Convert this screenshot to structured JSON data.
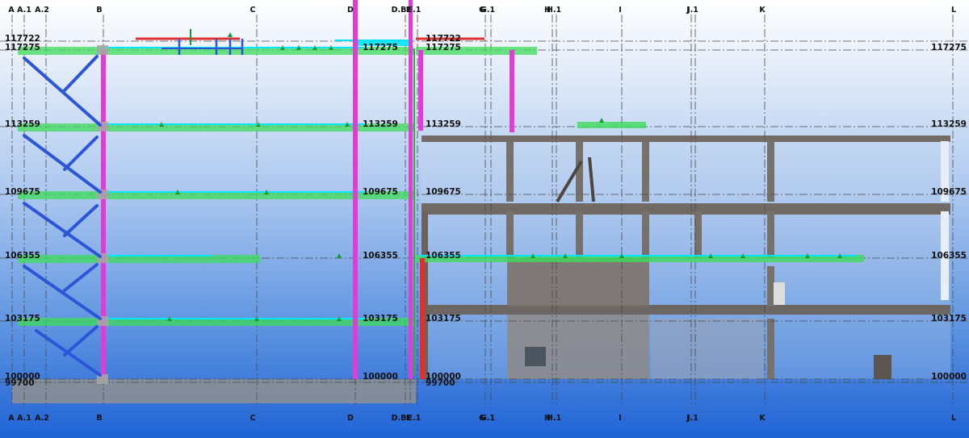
{
  "grids": {
    "labels": [
      "A",
      "A.1",
      "A.2",
      "B",
      "C",
      "D",
      "D.B",
      "E",
      "E.1",
      "G",
      "G.1",
      "H",
      "H.1",
      "I",
      "J",
      "J.1",
      "K",
      "L"
    ]
  },
  "levels": {
    "labels": [
      "117722",
      "117275",
      "113259",
      "109675",
      "106355",
      "103175",
      "100000",
      "99700"
    ]
  },
  "colors": {
    "floor_slab": "#3ddc5a",
    "slab_edge": "#00e5ff",
    "column_magenta": "#e23bd6",
    "brace_blue": "#2c56d8",
    "beam_red": "#e03030",
    "point_cloud": "#6a5f55",
    "foundation": "#8f8f8f"
  }
}
